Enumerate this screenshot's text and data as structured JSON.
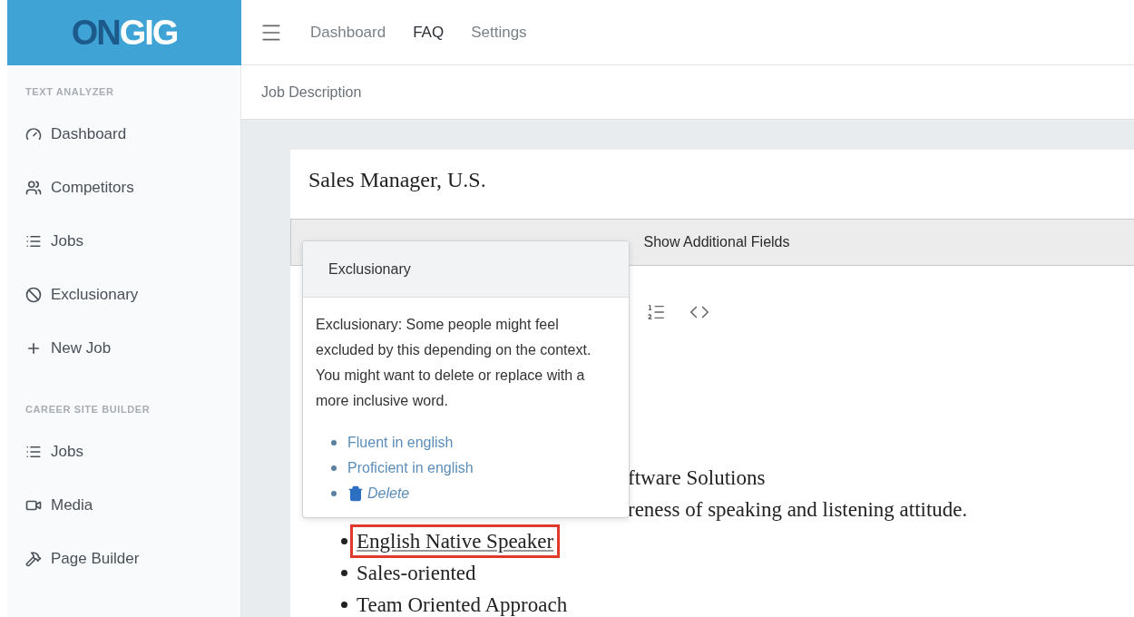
{
  "logo": {
    "first": "ON",
    "second": "GIG"
  },
  "top_nav": [
    {
      "label": "Dashboard",
      "selected": false
    },
    {
      "label": "FAQ",
      "selected": true
    },
    {
      "label": "Settings",
      "selected": false
    }
  ],
  "breadcrumb": "Job Description",
  "sidebar": [
    {
      "heading": "TEXT ANALYZER",
      "items": [
        {
          "label": "Dashboard"
        },
        {
          "label": "Competitors"
        },
        {
          "label": "Jobs"
        },
        {
          "label": "Exclusionary"
        },
        {
          "label": "New Job"
        }
      ]
    },
    {
      "heading": "CAREER SITE BUILDER",
      "items": [
        {
          "label": "Jobs"
        },
        {
          "label": "Media"
        },
        {
          "label": "Page Builder"
        }
      ]
    }
  ],
  "job_title": "Sales Manager, U.S.",
  "additional_fields_button": "Show Additional Fields",
  "editor_lines": [
    {
      "kind": "fragment",
      "text": "ftware Solutions"
    },
    {
      "kind": "fragment",
      "text": "reness of speaking and listening attitude."
    },
    {
      "kind": "bullet",
      "text": "English Native Speaker",
      "flagged": true
    },
    {
      "kind": "bullet",
      "text": "Sales-oriented",
      "flagged": false
    },
    {
      "kind": "bullet",
      "text": "Team Oriented Approach",
      "flagged": false
    }
  ],
  "popover": {
    "title": "Exclusionary",
    "message": "Exclusionary: Some people might feel excluded by this depending on the context. You might want to delete or replace with a more inclusive word.",
    "suggestions": [
      {
        "kind": "replace",
        "label": "Fluent in english"
      },
      {
        "kind": "replace",
        "label": "Proficient in english"
      },
      {
        "kind": "delete",
        "label": "Delete"
      }
    ]
  }
}
